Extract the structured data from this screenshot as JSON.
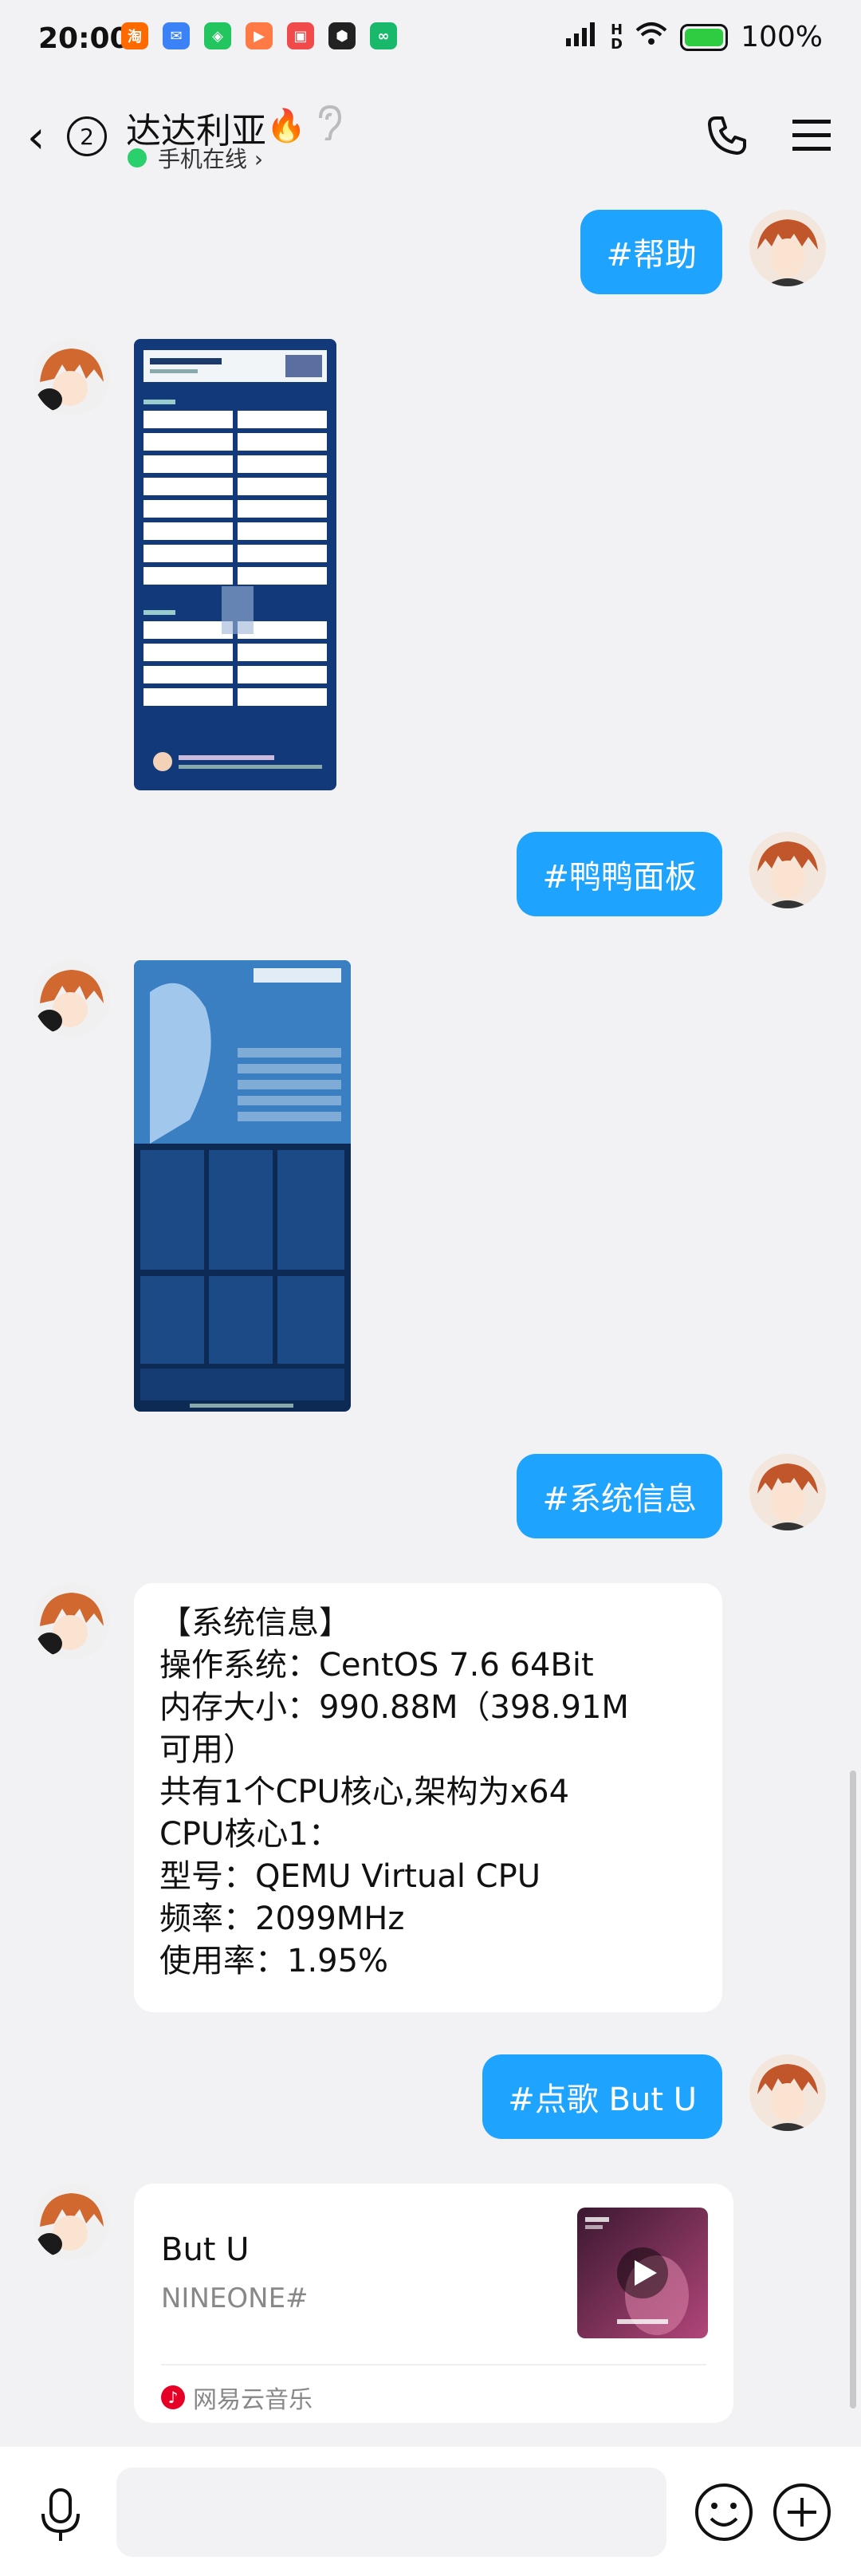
{
  "status_bar": {
    "time": "20:00",
    "battery": "100%",
    "apps": [
      {
        "icon": "taobao-icon",
        "color": "#ff6a00",
        "glyph": "淘"
      },
      {
        "icon": "mail-icon",
        "color": "#3b82f6",
        "glyph": "✉"
      },
      {
        "icon": "shield-app-icon",
        "color": "#22c55e",
        "glyph": "◈"
      },
      {
        "icon": "video-app-icon",
        "color": "#ff7a45",
        "glyph": "▶"
      },
      {
        "icon": "red-app-icon",
        "color": "#f04a4a",
        "glyph": "▣"
      },
      {
        "icon": "game-app-icon",
        "color": "#222222",
        "glyph": "⬢"
      },
      {
        "icon": "green-app-icon",
        "color": "#18b96b",
        "glyph": "∞"
      }
    ]
  },
  "header": {
    "back_count": "2",
    "title": "达达利亚",
    "status": "手机在线 ›"
  },
  "messages": {
    "help": "#帮助",
    "panel": "#鸭鸭面板",
    "sysinfo": "#系统信息",
    "sysinfo_reply": "【系统信息】\n操作系统：CentOS 7.6 64Bit\n内存大小：990.88M（398.91M\n可用）\n共有1个CPU核心,架构为x64\nCPU核心1：\n型号：QEMU Virtual CPU\n频率：2099MHz\n使用率：1.95%",
    "song_cmd": "#点歌 But U"
  },
  "music_card": {
    "title": "But U",
    "artist": "NINEONE#",
    "source": "网易云音乐"
  },
  "colors": {
    "accent": "#1ea4ff",
    "background": "#f2f2f4",
    "online": "#2ad06b"
  }
}
